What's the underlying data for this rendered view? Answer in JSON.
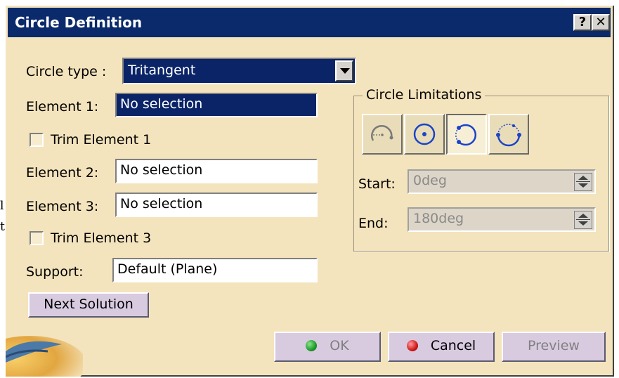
{
  "window": {
    "title": "Circle Definition",
    "help_button": "?",
    "close_button": "✕"
  },
  "background_text": {
    "line1": "l",
    "line2": "t"
  },
  "form": {
    "circle_type_label": "Circle type :",
    "circle_type_value": "Tritangent",
    "element1_label": "Element 1:",
    "element1_value": "No selection",
    "trim1_label": "Trim Element 1",
    "element2_label": "Element 2:",
    "element2_value": "No selection",
    "element3_label": "Element 3:",
    "element3_value": "No selection",
    "trim3_label": "Trim Element 3",
    "support_label": "Support:",
    "support_value": "Default (Plane)",
    "next_solution_label": "Next Solution"
  },
  "limitations": {
    "title": "Circle Limitations",
    "icons": [
      "partial-arc-icon",
      "full-circle-icon",
      "trimmed-circle-icon",
      "complementary-arc-icon"
    ],
    "start_label": "Start:",
    "start_value": "0deg",
    "end_label": "End:",
    "end_value": "180deg"
  },
  "buttons": {
    "ok_label": "OK",
    "cancel_label": "Cancel",
    "preview_label": "Preview"
  },
  "colors": {
    "dialog_bg": "#f4e4bd",
    "title_bar": "#0b2a6b",
    "selection": "#0a2467",
    "ok_dot": "#1f9a2a",
    "cancel_dot": "#d11a1a"
  }
}
